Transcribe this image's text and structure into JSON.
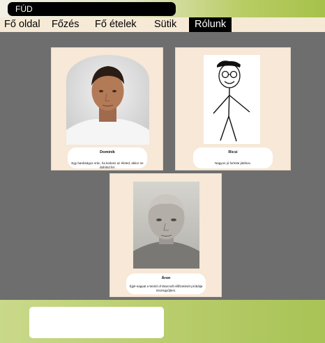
{
  "header": {
    "logo_text": "FÚD"
  },
  "nav": {
    "items": [
      {
        "label": "Fő oldal"
      },
      {
        "label": "Főzés"
      },
      {
        "label": "Fő ételek"
      },
      {
        "label": "Sütik"
      },
      {
        "label": "Rólunk"
      }
    ],
    "active": "Rólunk"
  },
  "cards": [
    {
      "name": "Dominik",
      "description": "Egy barátságos srác, ha kedves az életed, akkor ne dühítsd fel."
    },
    {
      "name": "Ricsi",
      "description": "Nagyon jó fortnite játékos."
    },
    {
      "name": "Áron",
      "description": "Éjjel-nappal a World of Warcraft előfizetését próbálja összegyűjteni."
    }
  ],
  "colors": {
    "page_background": "#6e6e6e",
    "card_background": "#f7e8d7",
    "nav_background": "#f6ead6",
    "accent_green": "#a6c24b"
  }
}
